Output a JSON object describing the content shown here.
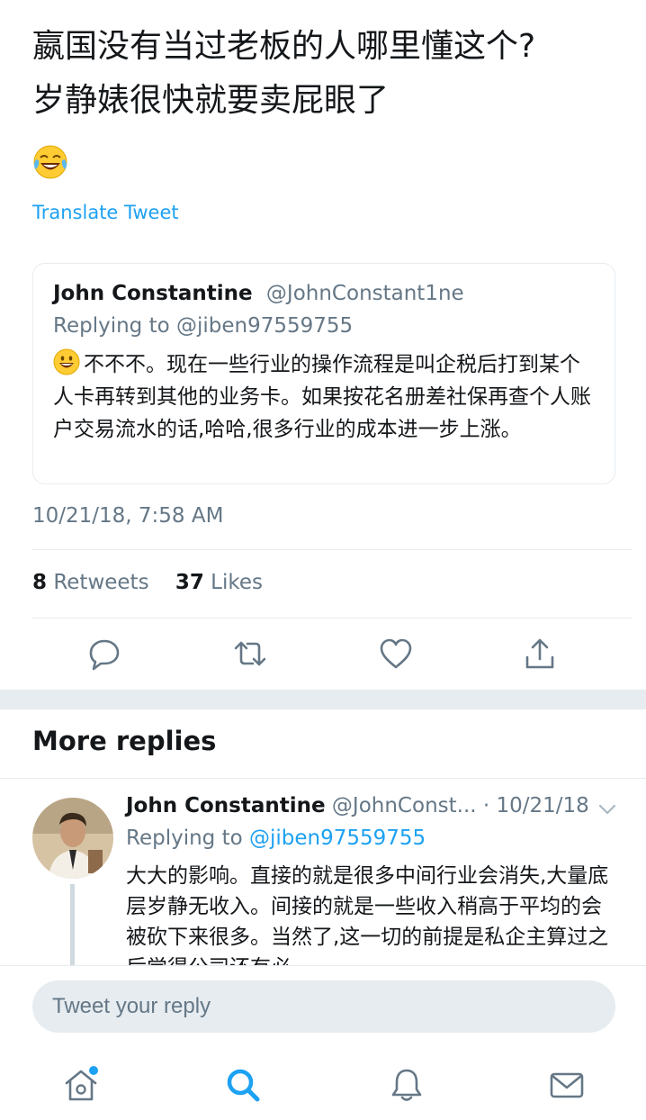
{
  "tweet": {
    "text_line1": "嬴国没有当过老板的人哪里懂这个?",
    "text_line2": "岁静婊很快就要卖屁眼了",
    "emoji": "face-with-tears-of-joy",
    "translate_label": "Translate Tweet"
  },
  "quoted_tweet": {
    "name": "John Constantine",
    "handle": "@JohnConstant1ne",
    "replying_to": "Replying to @jiben97559755",
    "emoji": "grinning-face",
    "body": "不不不。现在一些行业的操作流程是叫企税后打到某个人卡再转到其他的业务卡。如果按花名册差社保再查个人账户交易流水的话,哈哈,很多行业的成本进一步上涨。"
  },
  "timestamp": "10/21/18, 7:58 AM",
  "stats": {
    "retweets_count": "8",
    "retweets_label": "Retweets",
    "likes_count": "37",
    "likes_label": "Likes"
  },
  "actions": [
    "reply-icon",
    "retweet-icon",
    "like-icon",
    "share-icon"
  ],
  "more_replies": {
    "heading": "More replies"
  },
  "reply": {
    "name": "John Constantine",
    "handle_and_date": "@JohnConst... · 10/21/18",
    "replying_prefix": "Replying to",
    "replying_handle": "@jiben97559755",
    "body": "大大的影响。直接的就是很多中间行业会消失,大量底层岁静无收入。间接的就是一些收入稍高于平均的会被砍下来很多。当然了,这一切的前提是私企主算过之后觉得公司还有必"
  },
  "compose": {
    "placeholder": "Tweet your reply"
  },
  "tabbar": [
    "home-icon",
    "search-icon",
    "notifications-icon",
    "messages-icon"
  ],
  "colors": {
    "accent": "#1da1f2",
    "secondary_text": "#657786",
    "divider": "#e6ecf0",
    "icon": "#657786"
  }
}
